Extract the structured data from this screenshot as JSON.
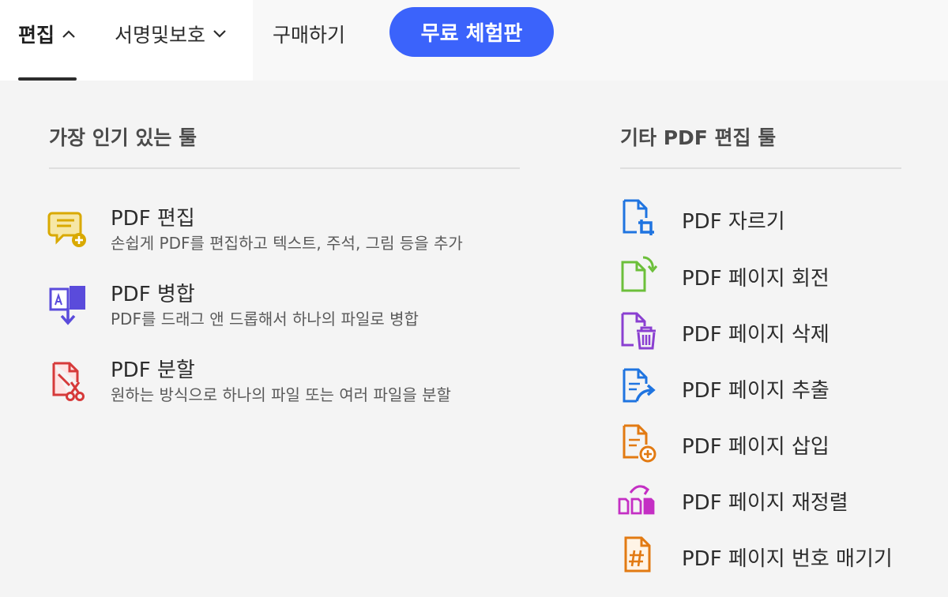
{
  "nav": {
    "edit_label": "편집",
    "sign_label": "서명및보호",
    "buy_label": "구매하기",
    "trial_label": "무료 체험판"
  },
  "popular": {
    "title": "가장 인기 있는 툴",
    "tools": [
      {
        "name": "PDF 편집",
        "desc": "손쉽게 PDF를 편집하고 텍스트, 주석, 그림 등을 추가",
        "icon": "edit-pdf-icon",
        "color": "#d9a900"
      },
      {
        "name": "PDF 병합",
        "desc": "PDF를 드래그 앤 드롭해서 하나의 파일로 병합",
        "icon": "merge-pdf-icon",
        "color": "#5a4bdb"
      },
      {
        "name": "PDF 분할",
        "desc": "원하는 방식으로 하나의 파일 또는 여러 파일을 분할",
        "icon": "split-pdf-icon",
        "color": "#d63a3a"
      }
    ]
  },
  "other": {
    "title": "기타 PDF 편집 툴",
    "tools": [
      {
        "name": "PDF 자르기",
        "icon": "crop-pdf-icon",
        "color": "#1f74e0"
      },
      {
        "name": "PDF 페이지 회전",
        "icon": "rotate-page-icon",
        "color": "#6cbf3a"
      },
      {
        "name": "PDF 페이지 삭제",
        "icon": "delete-page-icon",
        "color": "#8a3fd1"
      },
      {
        "name": "PDF 페이지 추출",
        "icon": "extract-page-icon",
        "color": "#1f74e0"
      },
      {
        "name": "PDF 페이지 삽입",
        "icon": "insert-page-icon",
        "color": "#e27a12"
      },
      {
        "name": "PDF 페이지 재정렬",
        "icon": "reorder-pages-icon",
        "color": "#c42fc4"
      },
      {
        "name": "PDF 페이지 번호 매기기",
        "icon": "number-pages-icon",
        "color": "#e27a12"
      }
    ]
  },
  "colors": {
    "accent": "#3b63fb",
    "background": "#f4f4f4"
  }
}
